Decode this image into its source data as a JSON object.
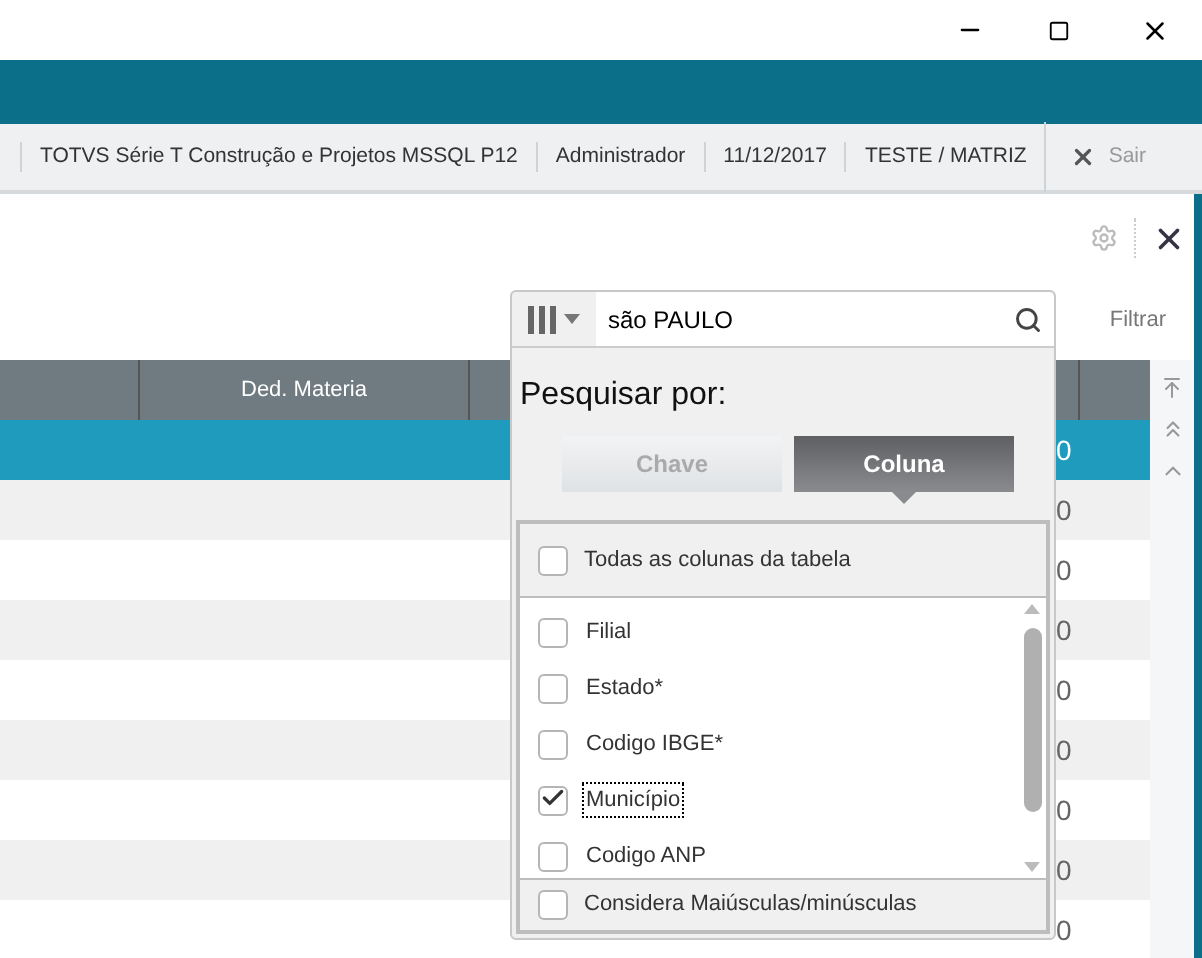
{
  "info_bar": {
    "items": [
      "TOTVS Série T Construção e Projetos MSSQL P12",
      "Administrador",
      "11/12/2017",
      "TESTE / MATRIZ"
    ],
    "exit": "Sair"
  },
  "toolbar": {
    "filter": "Filtrar"
  },
  "table": {
    "columns": [
      "Ded. Materia"
    ],
    "rows": [
      {
        "selected": true,
        "cell": "0"
      },
      {
        "selected": false,
        "cell": "0"
      },
      {
        "selected": false,
        "cell": "0"
      },
      {
        "selected": false,
        "cell": "0"
      },
      {
        "selected": false,
        "cell": "0"
      },
      {
        "selected": false,
        "cell": "0"
      },
      {
        "selected": false,
        "cell": "0"
      },
      {
        "selected": false,
        "cell": "0"
      },
      {
        "selected": false,
        "cell": "0"
      }
    ]
  },
  "search": {
    "value": "são PAULO",
    "heading": "Pesquisar por:",
    "modes": [
      {
        "label": "Chave",
        "selected": false
      },
      {
        "label": "Coluna",
        "selected": true
      }
    ],
    "all_columns": {
      "label": "Todas as colunas da tabela",
      "checked": false
    },
    "columns": [
      {
        "label": "Filial",
        "checked": false,
        "focused": false
      },
      {
        "label": "Estado*",
        "checked": false,
        "focused": false
      },
      {
        "label": "Codigo IBGE*",
        "checked": false,
        "focused": false
      },
      {
        "label": "Município",
        "checked": true,
        "focused": true
      },
      {
        "label": "Codigo ANP",
        "checked": false,
        "focused": false
      }
    ],
    "case_sensitive": {
      "label": "Considera Maiúsculas/minúsculas",
      "checked": false
    }
  }
}
